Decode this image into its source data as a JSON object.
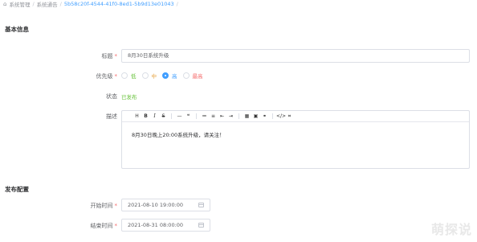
{
  "breadcrumb": {
    "items": [
      "系统管理",
      "系统通告",
      "5b58c20f-4544-41f0-8ed1-5b9d13e01043"
    ],
    "separator": "/"
  },
  "sections": {
    "basic": "基本信息",
    "publish": "发布配置"
  },
  "form": {
    "title_label": "标题",
    "title_value": "8月30日系统升级",
    "priority_label": "优先级",
    "priority_options": [
      {
        "label": "低",
        "color": "#67c23a",
        "selected": false
      },
      {
        "label": "中",
        "color": "#e6a23c",
        "selected": false
      },
      {
        "label": "高",
        "color": "#409eff",
        "selected": true
      },
      {
        "label": "最高",
        "color": "#f56c6c",
        "selected": false
      }
    ],
    "status_label": "状态",
    "status_value": "已发布",
    "desc_label": "描述",
    "desc_value": "8月30日晚上20:00系统升级，请关注！",
    "start_label": "开始时间",
    "start_value": "2021-08-10 19:00:00",
    "end_label": "结束时间",
    "end_value": "2021-08-31 08:00:00",
    "required_mark": "*"
  },
  "editor_toolbar": [
    "H",
    "B",
    "I",
    "S",
    "—",
    "❝",
    "≔",
    "≡",
    "⇤",
    "⇥",
    "▦",
    "▣",
    "⚭",
    "</>",
    "⌗"
  ],
  "watermark": "萌探说",
  "colors": {
    "accent": "#409eff",
    "success": "#67c23a",
    "danger": "#f56c6c"
  }
}
